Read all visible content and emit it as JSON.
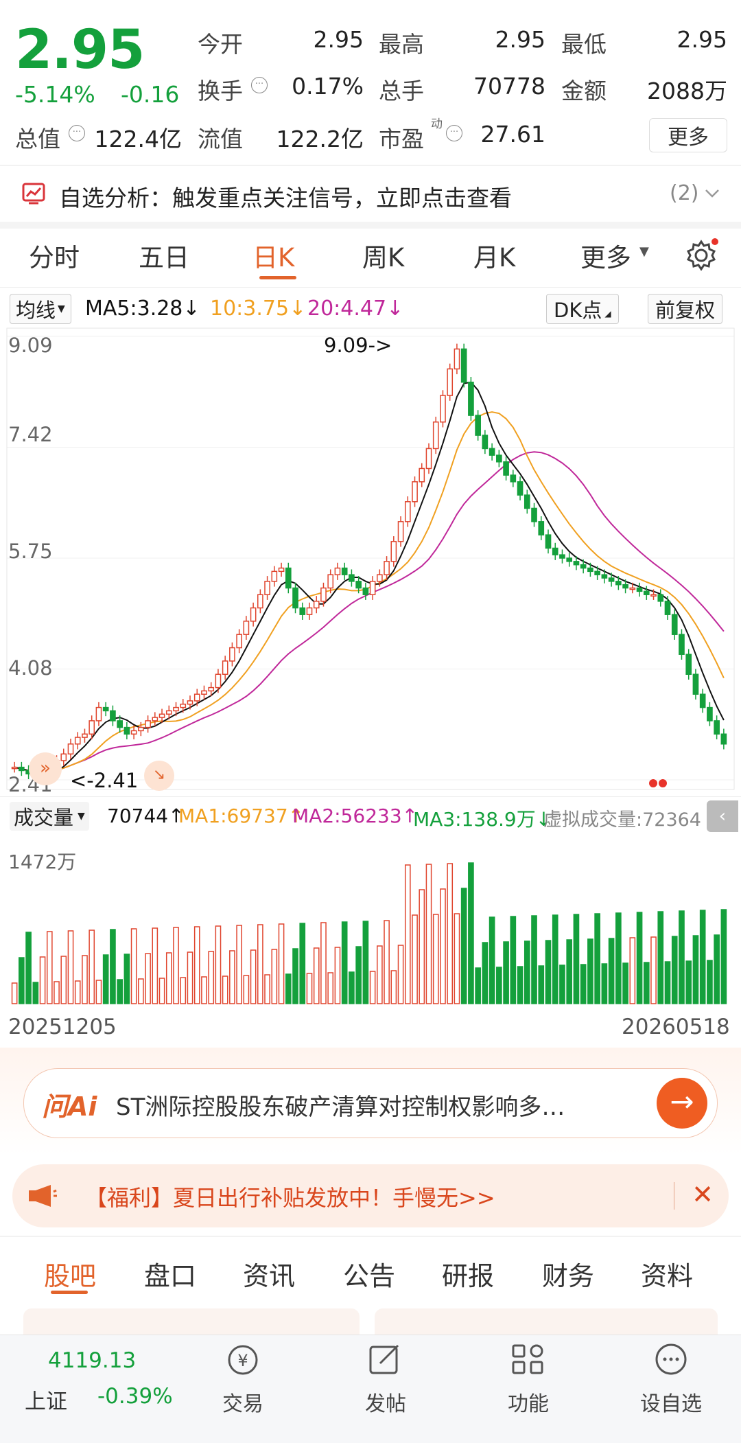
{
  "quote": {
    "price": "2.95",
    "change_pct": "-5.14%",
    "change": "-0.16",
    "labels": {
      "open": "今开",
      "high": "最高",
      "low": "最低",
      "turnover": "换手",
      "volume": "总手",
      "amount": "金额",
      "total_value": "总值",
      "float_value": "流值",
      "pe": "市盈"
    },
    "values": {
      "open": "2.95",
      "high": "2.95",
      "low": "2.95",
      "turnover": "0.17%",
      "volume": "70778",
      "amount": "2088万",
      "total_value": "122.4亿",
      "float_value": "122.2亿",
      "pe": "27.61"
    },
    "pe_sup": "动",
    "more_label": "更多"
  },
  "signal": {
    "text": "自选分析：触发重点关注信号，立即点击查看",
    "count": "(2)"
  },
  "tabs": [
    "分时",
    "五日",
    "日K",
    "周K",
    "月K",
    "更多"
  ],
  "active_tab": "日K",
  "ma_bar": {
    "selector": "均线",
    "ma5": "MA5:3.28",
    "ma10": "10:3.75",
    "ma20": "20:4.47",
    "dk": "DK点",
    "adjust": "前复权"
  },
  "price_axis": [
    "9.09",
    "7.42",
    "5.75",
    "4.08",
    "2.41"
  ],
  "price_annotations": {
    "high": "9.09->",
    "low": "<-2.41"
  },
  "volume_bar": {
    "selector": "成交量",
    "vol": "70744",
    "ma1": "MA1:69737",
    "ma2": "MA2:56233",
    "ma3": "MA3:138.9万",
    "virtual": "虚拟成交量:72364",
    "axis_max": "1472万"
  },
  "date_range": {
    "start": "20251205",
    "end": "20260518"
  },
  "ai_banner": {
    "brand": "问Ai",
    "text": "ST洲际控股股东破产清算对控制权影响多…"
  },
  "promo": {
    "text": "【福利】夏日出行补贴发放中！手慢无>>"
  },
  "bottom_tabs": [
    "股吧",
    "盘口",
    "资讯",
    "公告",
    "研报",
    "财务",
    "资料"
  ],
  "active_bottom_tab": "股吧",
  "dock": {
    "index_value": "4119.13",
    "index_name": "上证",
    "index_change": "-0.39%",
    "items": [
      "交易",
      "发帖",
      "功能",
      "设自选"
    ]
  },
  "colors": {
    "up": "#e0452e",
    "down": "#14a03c",
    "accent": "#e2632b",
    "ma5": "#111111",
    "ma10": "#f0a020",
    "ma20": "#c0289a"
  }
}
